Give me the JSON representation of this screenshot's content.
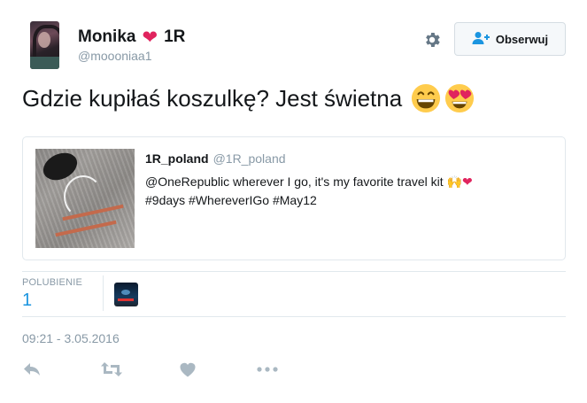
{
  "author": {
    "name": "Monika",
    "name_suffix": "1R",
    "handle": "@moooniaa1"
  },
  "follow_button": {
    "label": "Obserwuj"
  },
  "tweet": {
    "text": "Gdzie kupiłaś koszulkę? Jest świetna"
  },
  "quoted_tweet": {
    "name": "1R_poland",
    "handle": "@1R_poland",
    "line1": "@OneRepublic wherever I go, it's my favorite travel kit",
    "line1_emoji": "🙌❤",
    "line2": "#9days #WhereverIGo #May12"
  },
  "stats": {
    "likes_label": "POLUBIENIE",
    "likes_count": "1"
  },
  "timestamp": "09:21 - 3.05.2016",
  "colors": {
    "accent": "#1b95e0",
    "muted": "#8899a6",
    "heart": "#e0245e",
    "border": "#e1e8ed"
  },
  "icons": {
    "header": [
      "gear-icon",
      "follow-person-icon"
    ],
    "actions": [
      "reply-icon",
      "retweet-icon",
      "like-icon",
      "more-icon"
    ]
  }
}
